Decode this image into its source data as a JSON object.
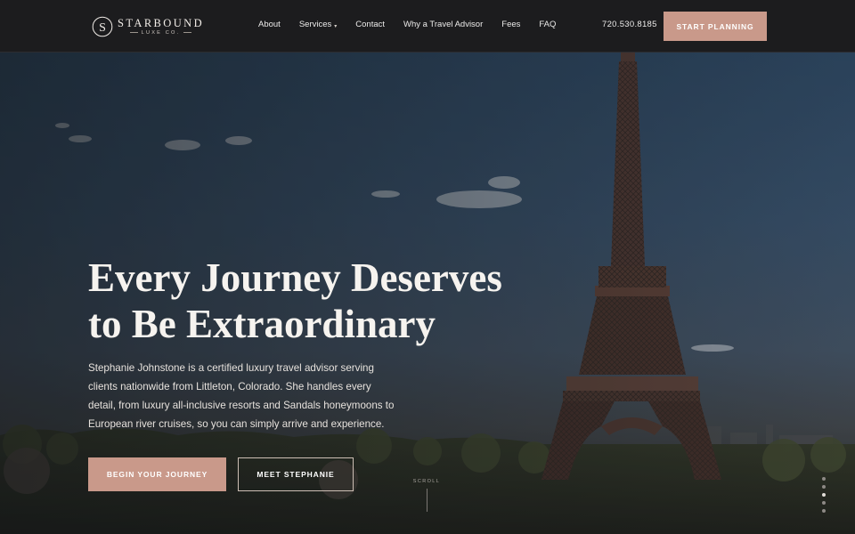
{
  "brand": {
    "monogram": "S",
    "name": "STARBOUND",
    "subtitle": "LUXE CO."
  },
  "nav": {
    "items": [
      {
        "label": "About"
      },
      {
        "label": "Services",
        "has_dropdown": true
      },
      {
        "label": "Contact"
      },
      {
        "label": "Why a Travel Advisor"
      },
      {
        "label": "Fees"
      },
      {
        "label": "FAQ"
      }
    ],
    "dropdown_glyph": "▾"
  },
  "header": {
    "phone": "720.530.8185",
    "cta_label": "START PLANNING"
  },
  "hero": {
    "title_line1": "Every Journey Deserves",
    "title_line2": "to Be Extraordinary",
    "description": "Stephanie Johnstone is a certified luxury travel advisor serving clients nationwide from Littleton, Colorado. She handles every detail, from luxury all-inclusive resorts and Sandals honeymoons to European river cruises, so you can simply arrive and experience.",
    "primary_cta": "BEGIN YOUR JOURNEY",
    "secondary_cta": "MEET STEPHANIE",
    "scroll_label": "SCROLL",
    "background": "Eiffel Tower, Paris"
  },
  "slider": {
    "count": 5,
    "active_index": 2
  },
  "colors": {
    "header_bg": "#1c1c1e",
    "accent": "#c9998a",
    "text_light": "#f6f3ef"
  },
  "icons": [
    "monogram-logo-icon",
    "chevron-down-icon",
    "scroll-line-icon",
    "slider-dot-icon"
  ]
}
